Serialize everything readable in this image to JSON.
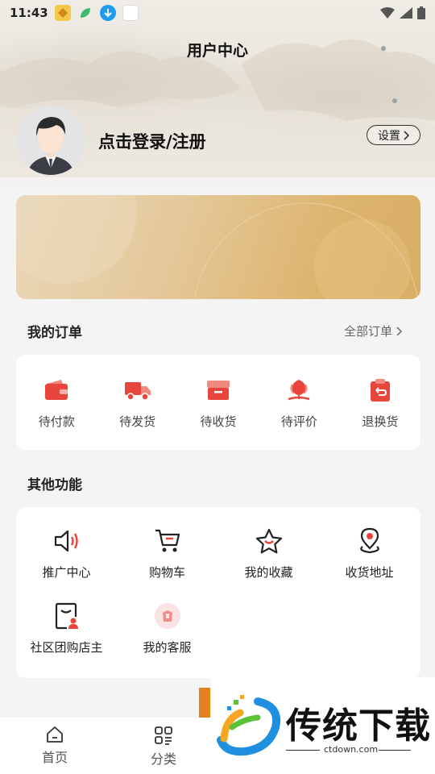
{
  "status_bar": {
    "time": "11:43",
    "app_icons": [
      "app-icon-orange",
      "app-icon-green-leaf",
      "app-icon-download",
      "app-icon-white"
    ],
    "right_icons": [
      "wifi-icon",
      "signal-icon",
      "battery-icon"
    ]
  },
  "header": {
    "title": "用户中心",
    "login_label": "点击登录/注册",
    "settings_label": "设置"
  },
  "orders": {
    "title": "我的订单",
    "all_orders_label": "全部订单",
    "items": [
      {
        "label": "待付款",
        "icon": "wallet-icon"
      },
      {
        "label": "待发货",
        "icon": "truck-icon"
      },
      {
        "label": "待收货",
        "icon": "package-icon"
      },
      {
        "label": "待评价",
        "icon": "flower-icon"
      },
      {
        "label": "退换货",
        "icon": "return-icon"
      }
    ]
  },
  "functions": {
    "title": "其他功能",
    "items": [
      {
        "label": "推广中心",
        "icon": "speaker-icon"
      },
      {
        "label": "购物车",
        "icon": "cart-icon"
      },
      {
        "label": "我的收藏",
        "icon": "star-icon"
      },
      {
        "label": "收货地址",
        "icon": "location-icon"
      },
      {
        "label": "社区团购店主",
        "icon": "shop-owner-icon"
      },
      {
        "label": "我的客服",
        "icon": "customer-service-icon"
      }
    ]
  },
  "tabbar": {
    "items": [
      {
        "label": "首页",
        "icon": "home-icon"
      },
      {
        "label": "分类",
        "icon": "category-icon"
      }
    ]
  },
  "watermark": {
    "text": "传统下载",
    "url": "ctdown.com"
  },
  "colors": {
    "accent": "#e8453c",
    "banner_gold": "#ddb46e",
    "page_bg": "#f4f4f4"
  }
}
